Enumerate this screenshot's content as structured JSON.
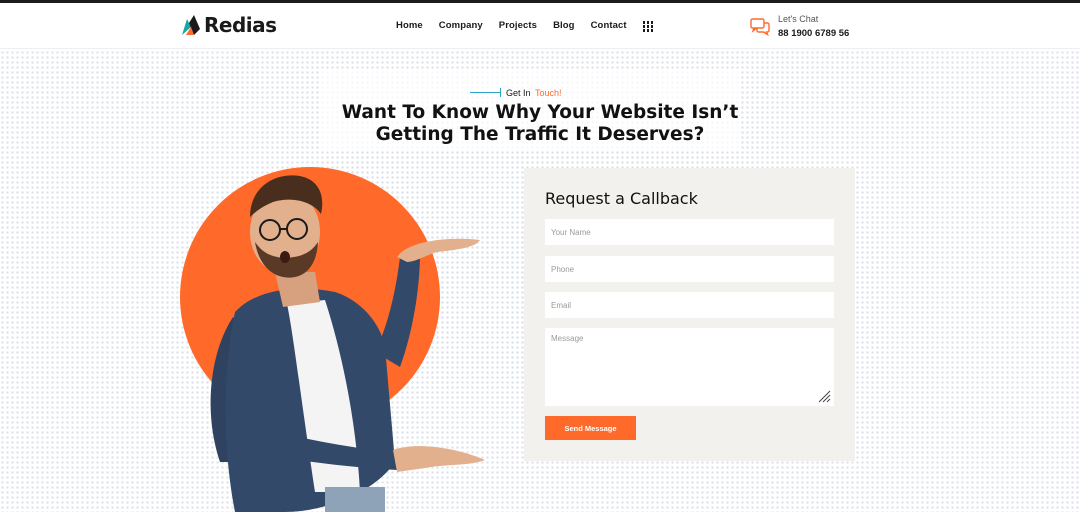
{
  "brand": {
    "name": "Redias",
    "accent": "#ff6a2b",
    "logo_teal": "#1aa6a0",
    "logo_dark": "#1a1a1a"
  },
  "nav": {
    "items": [
      {
        "label": "Home"
      },
      {
        "label": "Company"
      },
      {
        "label": "Projects"
      },
      {
        "label": "Blog"
      },
      {
        "label": "Contact"
      }
    ],
    "grid_icon": "grid-icon"
  },
  "chat": {
    "icon": "chat-bubbles-icon",
    "label": "Let's Chat",
    "phone": "88 1900 6789 56"
  },
  "hero": {
    "eyebrow_prefix": "Get In",
    "eyebrow_accent": "Touch!",
    "headline_line1": "Want To Know Why Your Website Isn’t",
    "headline_line2": "Getting The Traffic It Deserves?"
  },
  "form": {
    "title": "Request a Callback",
    "name_placeholder": "Your Name",
    "phone_placeholder": "Phone",
    "email_placeholder": "Email",
    "message_placeholder": "Message",
    "submit_label": "Send Message"
  }
}
